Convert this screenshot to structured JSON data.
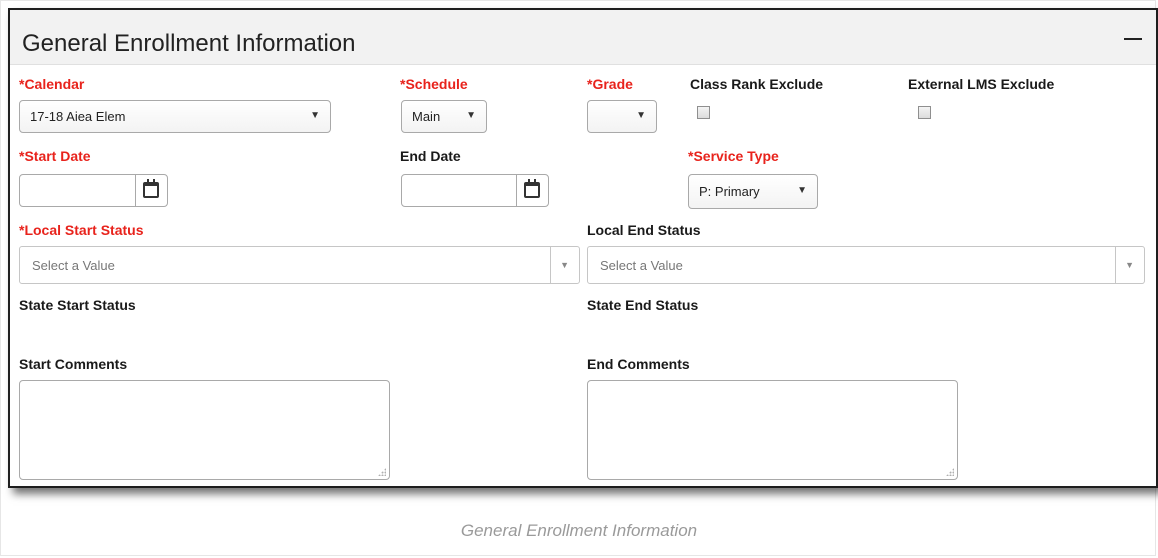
{
  "panel": {
    "title": "General Enrollment Information",
    "collapse_icon": "minus-icon"
  },
  "fields": {
    "calendar": {
      "label": "*Calendar",
      "value": "17-18 Aiea Elem"
    },
    "schedule": {
      "label": "*Schedule",
      "value": "Main"
    },
    "grade": {
      "label": "*Grade",
      "value": ""
    },
    "class_rank_exclude": {
      "label": "Class Rank Exclude",
      "checked": false
    },
    "external_lms_exclude": {
      "label": "External LMS Exclude",
      "checked": false
    },
    "start_date": {
      "label": "*Start Date",
      "value": ""
    },
    "end_date": {
      "label": "End Date",
      "value": ""
    },
    "service_type": {
      "label": "*Service Type",
      "value": "P: Primary"
    },
    "local_start_status": {
      "label": "*Local Start Status",
      "placeholder": "Select a Value"
    },
    "local_end_status": {
      "label": "Local End Status",
      "placeholder": "Select a Value"
    },
    "state_start_status": {
      "label": "State Start Status"
    },
    "state_end_status": {
      "label": "State End Status"
    },
    "start_comments": {
      "label": "Start Comments",
      "value": ""
    },
    "end_comments": {
      "label": "End Comments",
      "value": ""
    }
  },
  "icons": {
    "dropdown": "triangle-down-icon",
    "calendar": "calendar-icon"
  },
  "colors": {
    "required_label": "#e8231c",
    "header_bg": "#f2f2f2"
  },
  "caption": "General Enrollment Information"
}
